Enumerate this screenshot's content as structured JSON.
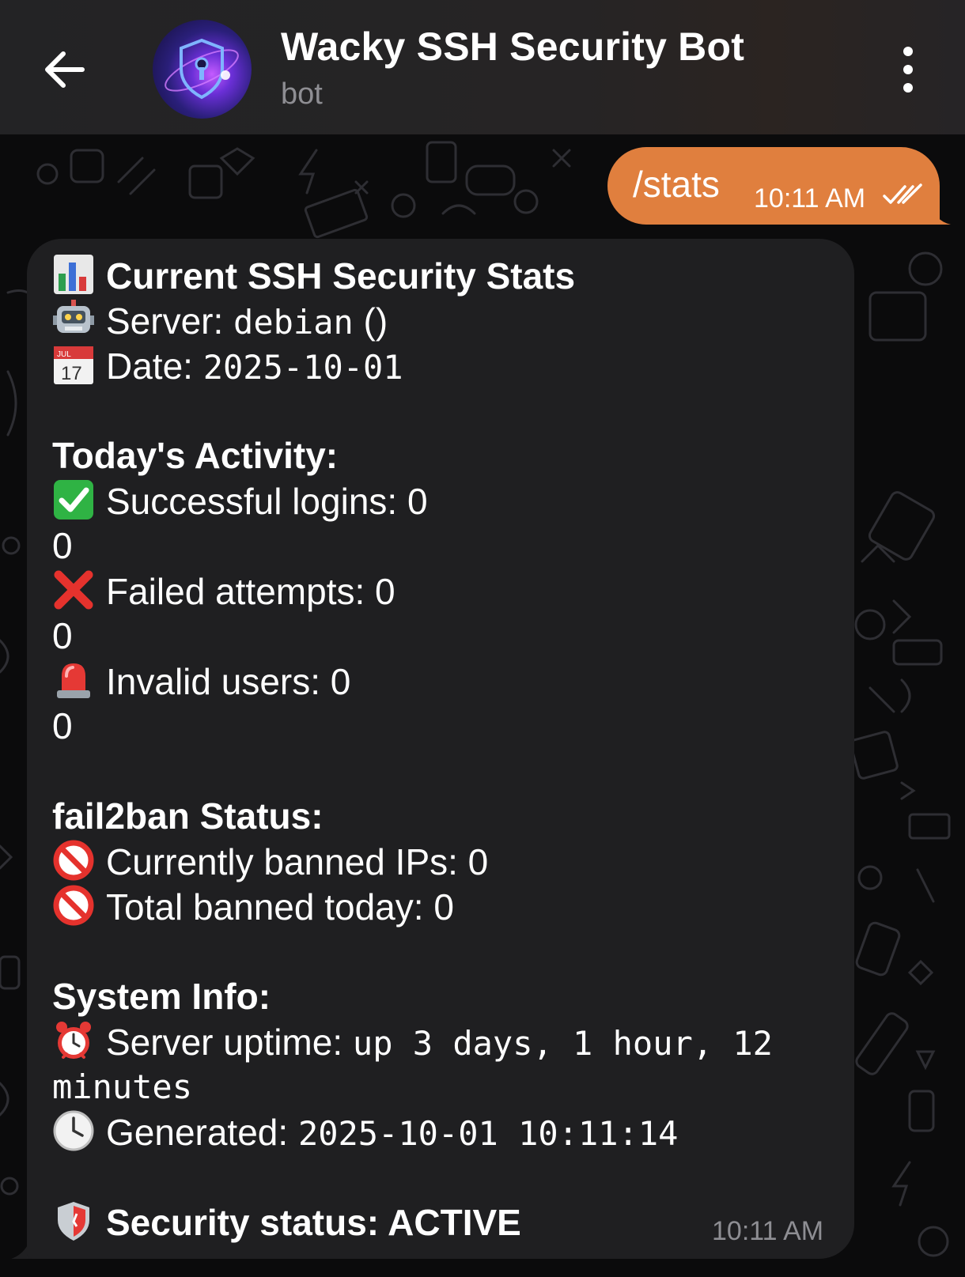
{
  "header": {
    "title": "Wacky SSH Security Bot",
    "subtitle": "bot"
  },
  "outgoing": {
    "text": "/stats",
    "time": "10:11 AM",
    "status": "read"
  },
  "incoming": {
    "time": "10:11 AM",
    "lines": {
      "title": "Current SSH Security Stats",
      "server_label": "Server:",
      "server_value": "debian",
      "server_suffix": " ()",
      "date_label": "Date:",
      "date_value": "2025-10-01",
      "activity_heading": "Today's Activity:",
      "successful_logins": "Successful logins: 0",
      "successful_logins_extra": "0",
      "failed_attempts": "Failed attempts: 0",
      "failed_attempts_extra": "0",
      "invalid_users": "Invalid users: 0",
      "invalid_users_extra": "0",
      "fail2ban_heading": "fail2ban Status:",
      "currently_banned": "Currently banned IPs: 0",
      "total_banned": "Total banned today: 0",
      "system_heading": "System Info:",
      "uptime_label": "Server uptime:",
      "uptime_value_line1": "up 3 days, 1 hour, 12",
      "uptime_value_line2": "minutes",
      "generated_label": "Generated:",
      "generated_value": "2025-10-01 10:11:14",
      "security_status": "Security status: ACTIVE"
    }
  },
  "colors": {
    "outgoing_bubble": "#e07f3e",
    "incoming_bubble": "#1f1f21",
    "header": "#232325",
    "background": "#0b0b0c"
  }
}
